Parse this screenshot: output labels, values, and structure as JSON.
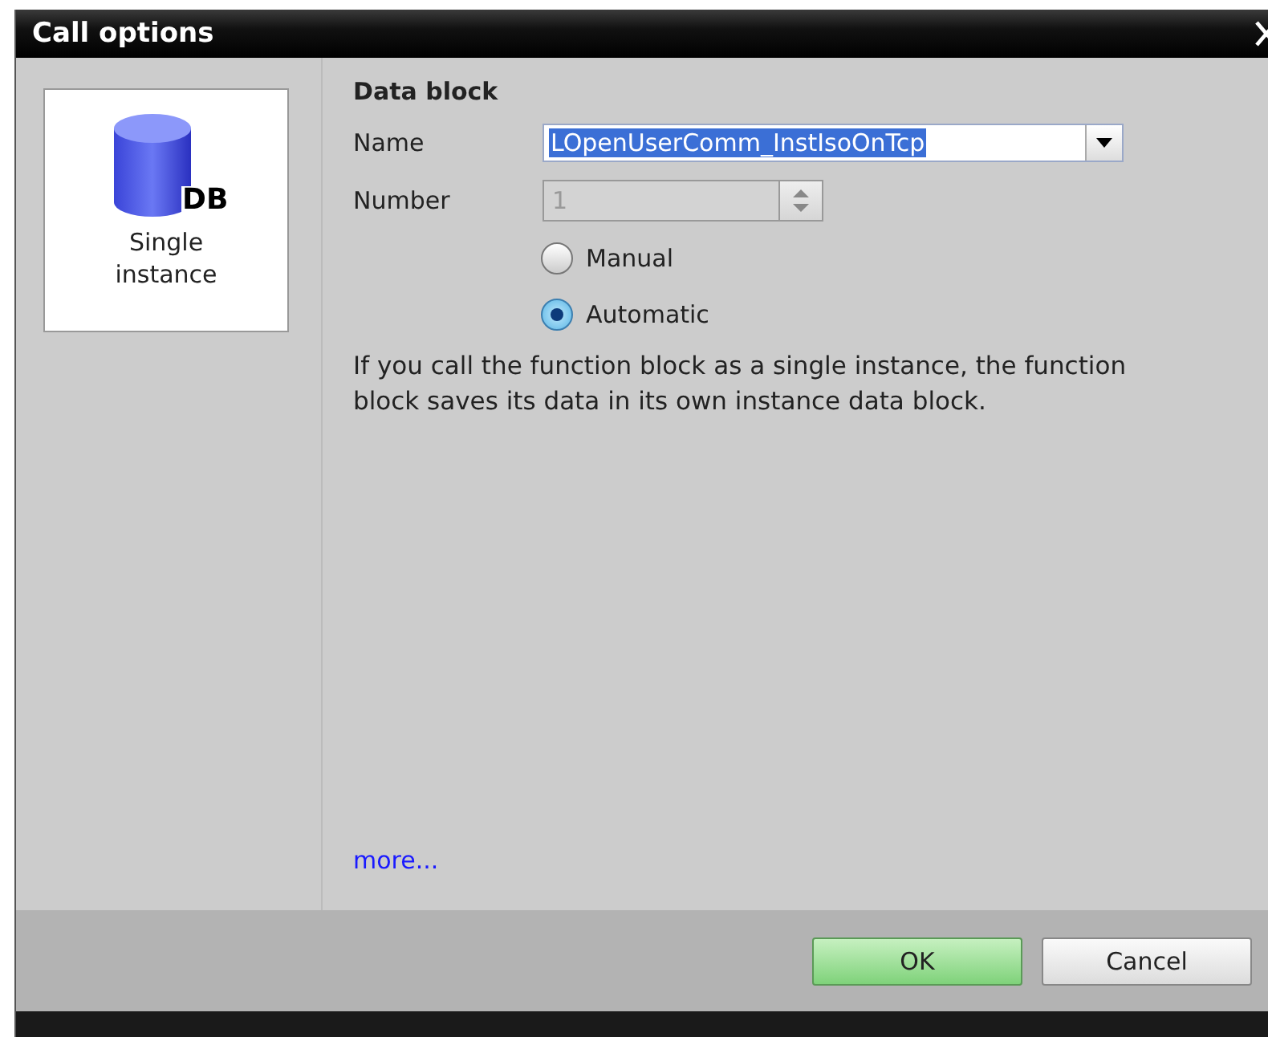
{
  "window": {
    "title": "Call options"
  },
  "call_types": [
    {
      "icon_text": "DB",
      "label": "Single instance",
      "selected": true
    }
  ],
  "data_block": {
    "title": "Data block",
    "name": {
      "label": "Name",
      "value": "LOpenUserComm_InstIsoOnTcp",
      "selected_text": true
    },
    "number": {
      "label": "Number",
      "value": "1",
      "disabled": true
    },
    "numbering": [
      {
        "label": "Manual",
        "selected": false
      },
      {
        "label": "Automatic",
        "selected": true
      }
    ],
    "description": "If you call the function block as a single instance, the function block saves its data in its own instance data block.",
    "more_link": "more..."
  },
  "buttons": [
    {
      "label": "OK",
      "kind": "primary"
    },
    {
      "label": "Cancel",
      "kind": "secondary"
    }
  ]
}
